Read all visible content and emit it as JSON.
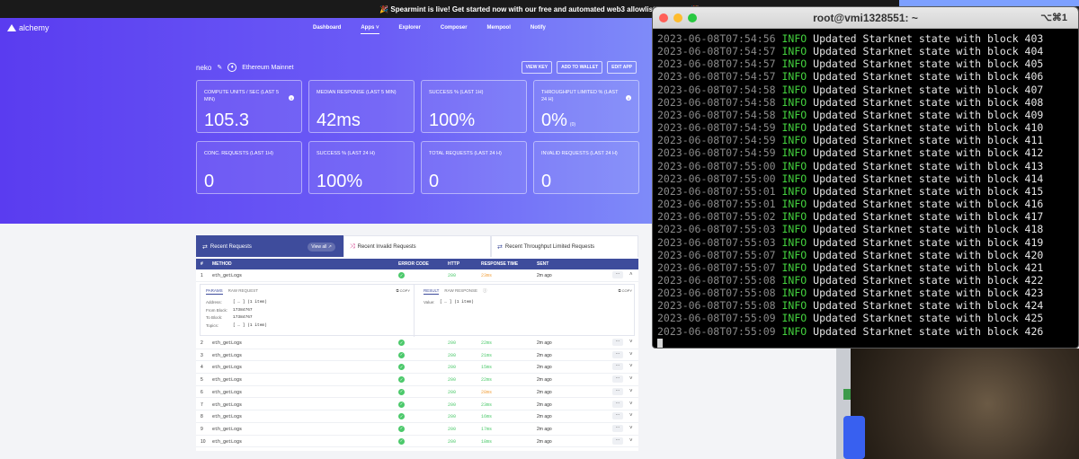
{
  "banner": "🎉 Spearmint is live! Get started now with our free and automated web3 allowlist platform! 🎉",
  "logo": "alchemy",
  "nav": [
    "Dashboard",
    "Apps ˅",
    "Explorer",
    "Composer",
    "Mempool",
    "Notify"
  ],
  "app": {
    "name": "neko",
    "edit_icon": "pencil-icon",
    "network": "Ethereum Mainnet"
  },
  "actions": [
    "VIEW KEY",
    "ADD TO WALLET",
    "EDIT APP"
  ],
  "stats": [
    {
      "label": "COMPUTE UNITS / SEC (LAST 5 MIN)",
      "value": "105.3",
      "info": true
    },
    {
      "label": "MEDIAN RESPONSE (LAST 5 MIN)",
      "value": "42ms"
    },
    {
      "label": "SUCCESS % (LAST 1H)",
      "value": "100%"
    },
    {
      "label": "THROUGHPUT LIMITED % (LAST 24 H)",
      "value": "0%",
      "sub": "(0)",
      "info": true
    },
    {
      "label": "CONC. REQUESTS (LAST 1H)",
      "value": "0"
    },
    {
      "label": "SUCCESS % (LAST 24 H)",
      "value": "100%"
    },
    {
      "label": "TOTAL REQUESTS (LAST 24 H)",
      "value": "0"
    },
    {
      "label": "INVALID REQUESTS (LAST 24 H)",
      "value": "0"
    }
  ],
  "tabs": {
    "recent": "Recent Requests",
    "view_all": "View all ↗",
    "invalid": "Recent Invalid Requests",
    "throttled": "Recent Throughput Limited Requests"
  },
  "table_headers": [
    "#",
    "METHOD",
    "ERROR CODE",
    "HTTP",
    "RESPONSE TIME",
    "SENT"
  ],
  "rows": [
    {
      "n": "1",
      "method": "eth_getLogs",
      "http": "200",
      "rt": "23ms",
      "sent": "2m ago",
      "slow": true
    },
    {
      "n": "2",
      "method": "eth_getLogs",
      "http": "200",
      "rt": "22ms",
      "sent": "2m ago"
    },
    {
      "n": "3",
      "method": "eth_getLogs",
      "http": "200",
      "rt": "21ms",
      "sent": "2m ago"
    },
    {
      "n": "4",
      "method": "eth_getLogs",
      "http": "200",
      "rt": "15ms",
      "sent": "2m ago"
    },
    {
      "n": "5",
      "method": "eth_getLogs",
      "http": "200",
      "rt": "22ms",
      "sent": "2m ago"
    },
    {
      "n": "6",
      "method": "eth_getLogs",
      "http": "200",
      "rt": "28ms",
      "sent": "2m ago",
      "slow": true
    },
    {
      "n": "7",
      "method": "eth_getLogs",
      "http": "200",
      "rt": "23ms",
      "sent": "2m ago"
    },
    {
      "n": "8",
      "method": "eth_getLogs",
      "http": "200",
      "rt": "16ms",
      "sent": "2m ago"
    },
    {
      "n": "9",
      "method": "eth_getLogs",
      "http": "200",
      "rt": "17ms",
      "sent": "2m ago"
    },
    {
      "n": "10",
      "method": "eth_getLogs",
      "http": "200",
      "rt": "18ms",
      "sent": "2m ago"
    }
  ],
  "detail": {
    "req_tabs": [
      "PARAMS",
      "RAW REQUEST"
    ],
    "res_tabs": [
      "RESULT",
      "RAW RESPONSE"
    ],
    "copy": "COPY",
    "params": [
      {
        "k": "Address:",
        "v": "[ … ] (1 item)"
      },
      {
        "k": "From Block:",
        "v": "17384767"
      },
      {
        "k": "To Block:",
        "v": "17384767"
      },
      {
        "k": "Topics:",
        "v": "[ … ] (1 item)"
      }
    ],
    "result": {
      "k": "Value:",
      "v": "[ … ] (1 item)"
    }
  },
  "terminal": {
    "title": "root@vmi1328551: ~",
    "shortcut": "⌥⌘1",
    "lines": [
      {
        "ts": "2023-06-08T07:54:56",
        "lv": "INFO",
        "msg": "Updated Starknet state with block 403"
      },
      {
        "ts": "2023-06-08T07:54:57",
        "lv": "INFO",
        "msg": "Updated Starknet state with block 404"
      },
      {
        "ts": "2023-06-08T07:54:57",
        "lv": "INFO",
        "msg": "Updated Starknet state with block 405"
      },
      {
        "ts": "2023-06-08T07:54:57",
        "lv": "INFO",
        "msg": "Updated Starknet state with block 406"
      },
      {
        "ts": "2023-06-08T07:54:58",
        "lv": "INFO",
        "msg": "Updated Starknet state with block 407"
      },
      {
        "ts": "2023-06-08T07:54:58",
        "lv": "INFO",
        "msg": "Updated Starknet state with block 408"
      },
      {
        "ts": "2023-06-08T07:54:58",
        "lv": "INFO",
        "msg": "Updated Starknet state with block 409"
      },
      {
        "ts": "2023-06-08T07:54:59",
        "lv": "INFO",
        "msg": "Updated Starknet state with block 410"
      },
      {
        "ts": "2023-06-08T07:54:59",
        "lv": "INFO",
        "msg": "Updated Starknet state with block 411"
      },
      {
        "ts": "2023-06-08T07:54:59",
        "lv": "INFO",
        "msg": "Updated Starknet state with block 412"
      },
      {
        "ts": "2023-06-08T07:55:00",
        "lv": "INFO",
        "msg": "Updated Starknet state with block 413"
      },
      {
        "ts": "2023-06-08T07:55:00",
        "lv": "INFO",
        "msg": "Updated Starknet state with block 414"
      },
      {
        "ts": "2023-06-08T07:55:01",
        "lv": "INFO",
        "msg": "Updated Starknet state with block 415"
      },
      {
        "ts": "2023-06-08T07:55:01",
        "lv": "INFO",
        "msg": "Updated Starknet state with block 416"
      },
      {
        "ts": "2023-06-08T07:55:02",
        "lv": "INFO",
        "msg": "Updated Starknet state with block 417"
      },
      {
        "ts": "2023-06-08T07:55:03",
        "lv": "INFO",
        "msg": "Updated Starknet state with block 418"
      },
      {
        "ts": "2023-06-08T07:55:03",
        "lv": "INFO",
        "msg": "Updated Starknet state with block 419"
      },
      {
        "ts": "2023-06-08T07:55:07",
        "lv": "INFO",
        "msg": "Updated Starknet state with block 420"
      },
      {
        "ts": "2023-06-08T07:55:07",
        "lv": "INFO",
        "msg": "Updated Starknet state with block 421"
      },
      {
        "ts": "2023-06-08T07:55:08",
        "lv": "INFO",
        "msg": "Updated Starknet state with block 422"
      },
      {
        "ts": "2023-06-08T07:55:08",
        "lv": "INFO",
        "msg": "Updated Starknet state with block 423"
      },
      {
        "ts": "2023-06-08T07:55:08",
        "lv": "INFO",
        "msg": "Updated Starknet state with block 424"
      },
      {
        "ts": "2023-06-08T07:55:09",
        "lv": "INFO",
        "msg": "Updated Starknet state with block 425"
      },
      {
        "ts": "2023-06-08T07:55:09",
        "lv": "INFO",
        "msg": "Updated Starknet state with block 426"
      }
    ]
  },
  "colors": {
    "brand": "#5a3cf0",
    "table_header": "#3e4c9c",
    "success": "#4cc96b",
    "warn": "#f2a240",
    "term_info": "#44d33e"
  }
}
